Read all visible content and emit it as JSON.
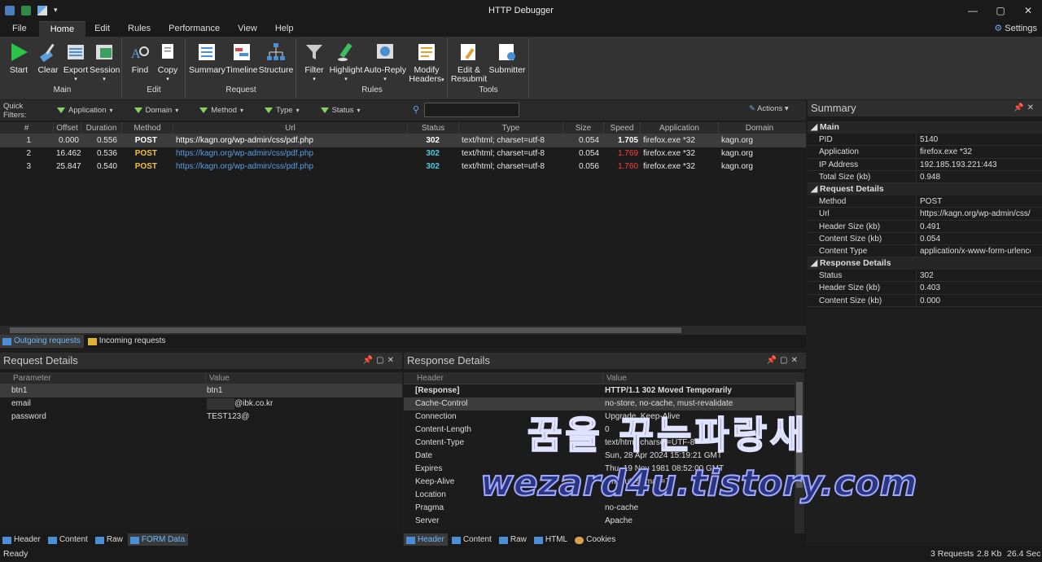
{
  "window": {
    "title": "HTTP Debugger",
    "minimize": "—",
    "restore": "▢",
    "close": "✕"
  },
  "menu": {
    "items": [
      "File",
      "Home",
      "Edit",
      "Rules",
      "Performance",
      "View",
      "Help"
    ],
    "settings": "Settings"
  },
  "ribbon": {
    "groups": {
      "main": "Main",
      "edit": "Edit",
      "request": "Request",
      "rules": "Rules",
      "tools": "Tools"
    },
    "buttons": {
      "start": "Start",
      "clear": "Clear",
      "export": "Export",
      "session": "Session",
      "find": "Find",
      "copy": "Copy",
      "summary": "Summary",
      "timeline": "Timeline",
      "structure": "Structure",
      "filter": "Filter",
      "highlight": "Highlight",
      "autoreply": "Auto-Reply",
      "modify1": "Modify",
      "modify2": "Headers",
      "edit1": "Edit &",
      "edit2": "Resubmit",
      "submitter": "Submitter"
    }
  },
  "quickfilters": {
    "label": "Quick Filters:",
    "items": [
      "Application",
      "Domain",
      "Method",
      "Type",
      "Status"
    ],
    "actions": "Actions"
  },
  "grid": {
    "headers": [
      "#",
      "Offset",
      "Duration",
      "Method",
      "Url",
      "Status",
      "Type",
      "Size",
      "Speed",
      "Application",
      "Domain"
    ],
    "rows": [
      [
        "1",
        "0.000",
        "0.556",
        "POST",
        "https://kagn.org/wp-admin/css/pdf.php",
        "302",
        "text/html; charset=utf-8",
        "0.054",
        "1.705",
        "firefox.exe *32",
        "kagn.org"
      ],
      [
        "2",
        "16.462",
        "0.536",
        "POST",
        "https://kagn.org/wp-admin/css/pdf.php",
        "302",
        "text/html; charset=utf-8",
        "0.054",
        "1.769",
        "firefox.exe *32",
        "kagn.org"
      ],
      [
        "3",
        "25.847",
        "0.540",
        "POST",
        "https://kagn.org/wp-admin/css/pdf.php",
        "302",
        "text/html; charset=utf-8",
        "0.056",
        "1.760",
        "firefox.exe *32",
        "kagn.org"
      ]
    ]
  },
  "traffic_tabs": {
    "outgoing": "Outgoing requests",
    "incoming": "Incoming requests"
  },
  "summary": {
    "title": "Summary",
    "main": {
      "title": "Main",
      "rows": [
        [
          "PID",
          "5140"
        ],
        [
          "Application",
          "firefox.exe *32"
        ],
        [
          "IP Address",
          "192.185.193.221:443"
        ],
        [
          "Total Size (kb)",
          "0.948"
        ]
      ]
    },
    "request": {
      "title": "Request Details",
      "rows": [
        [
          "Method",
          "POST"
        ],
        [
          "Url",
          "https://kagn.org/wp-admin/css/"
        ],
        [
          "Header Size (kb)",
          "0.491"
        ],
        [
          "Content Size (kb)",
          "0.054"
        ],
        [
          "Content Type",
          "application/x-www-form-urlenco"
        ]
      ]
    },
    "response": {
      "title": "Response Details",
      "rows": [
        [
          "Status",
          "302"
        ],
        [
          "Header Size (kb)",
          "0.403"
        ],
        [
          "Content Size (kb)",
          "0.000"
        ]
      ]
    }
  },
  "request_details": {
    "title": "Request Details",
    "headers": [
      "Parameter",
      "Value"
    ],
    "rows": [
      [
        "btn1",
        "btn1"
      ],
      [
        "email",
        "@ibk.co.kr"
      ],
      [
        "password",
        "TEST123@"
      ]
    ],
    "tabs": [
      "Header",
      "Content",
      "Raw",
      "FORM Data"
    ]
  },
  "response_details": {
    "title": "Response Details",
    "headers": [
      "Header",
      "Value"
    ],
    "rows": [
      [
        "[Response]",
        "HTTP/1.1 302 Moved Temporarily"
      ],
      [
        "Cache-Control",
        "no-store, no-cache, must-revalidate"
      ],
      [
        "Connection",
        "Upgrade, Keep-Alive"
      ],
      [
        "Content-Length",
        "0"
      ],
      [
        "Content-Type",
        "text/html; charset=UTF-8"
      ],
      [
        "Date",
        "Sun, 28 Apr 2024 15:19:21 GMT"
      ],
      [
        "Expires",
        "Thu, 19 Nov 1981 08:52:00 GMT"
      ],
      [
        "Keep-Alive",
        "timeout=5, max=75"
      ],
      [
        "Location",
        ""
      ],
      [
        "Pragma",
        "no-cache"
      ],
      [
        "Server",
        "Apache"
      ]
    ],
    "tabs": [
      "Header",
      "Content",
      "Raw",
      "HTML",
      "Cookies"
    ]
  },
  "watermark": {
    "line1": "꿈을 꾸는파랑새",
    "line2": "wezard4u.tistory.com"
  },
  "status": {
    "ready": "Ready",
    "requests": "3 Requests",
    "size": "2.8 Kb",
    "speed": "26.4 Sec"
  },
  "colors": {
    "accent": "#6ab8ff",
    "method": "#f0c040",
    "status302": "#4fc8d8",
    "speedRed": "#ff4040",
    "link": "#5a9ee0"
  }
}
